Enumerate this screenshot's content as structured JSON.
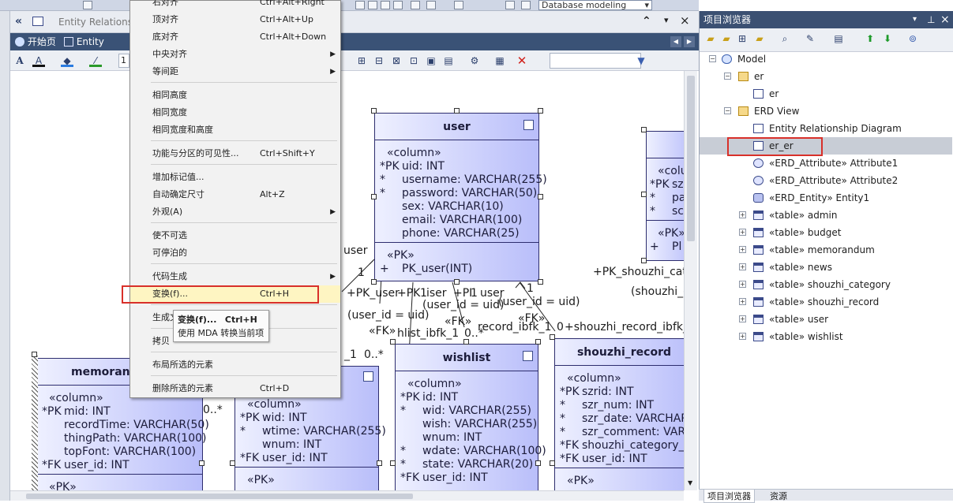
{
  "toolbar": {
    "diagram_type_combo": "Database modeling",
    "combo_arrow": "▾"
  },
  "doc_header": {
    "title": "Entity Relationship",
    "collapse": "«",
    "up": "⌃",
    "close": "×",
    "dropdown": "▾"
  },
  "tabs": {
    "start": "开始页",
    "diagram": "Entity Relatic",
    "prev": "◀",
    "next": "▶"
  },
  "format_toolbar": {
    "font_a": "A",
    "zoom_value": "1"
  },
  "context_menu": {
    "items": [
      {
        "label": "右对齐",
        "shortcut": "Ctrl+Alt+Right"
      },
      {
        "label": "顶对齐",
        "shortcut": "Ctrl+Alt+Up"
      },
      {
        "label": "底对齐",
        "shortcut": "Ctrl+Alt+Down"
      },
      {
        "label": "中央对齐",
        "shortcut": "",
        "submenu": true
      },
      {
        "label": "等间距",
        "shortcut": "",
        "submenu": true
      },
      {
        "label": "相同高度",
        "shortcut": ""
      },
      {
        "label": "相同宽度",
        "shortcut": ""
      },
      {
        "label": "相同宽度和高度",
        "shortcut": ""
      },
      {
        "label": "功能与分区的可见性...",
        "shortcut": "Ctrl+Shift+Y"
      },
      {
        "label": "增加标记值...",
        "shortcut": ""
      },
      {
        "label": "自动确定尺寸",
        "shortcut": "Alt+Z"
      },
      {
        "label": "外观(A)",
        "shortcut": "",
        "submenu": true
      },
      {
        "label": "使不可选",
        "shortcut": ""
      },
      {
        "label": "可停泊的",
        "shortcut": ""
      },
      {
        "label": "代码生成",
        "shortcut": "",
        "submenu": true
      },
      {
        "label": "变换(f)...",
        "shortcut": "Ctrl+H"
      },
      {
        "label": "生成文",
        "shortcut": ""
      },
      {
        "label": "拷贝",
        "shortcut": ""
      },
      {
        "label": "布局所选的元素",
        "shortcut": ""
      },
      {
        "label": "删除所选的元素",
        "shortcut": "Ctrl+D"
      }
    ],
    "submenu_arrow": "▶"
  },
  "tooltip": {
    "title": "变换(f)...",
    "shortcut": "Ctrl+H",
    "desc": "使用 MDA 转换当前项"
  },
  "entities": {
    "user": {
      "name": "user",
      "column_stereo": "«column»",
      "columns": [
        {
          "prefix": "*PK",
          "text": "uid: INT"
        },
        {
          "prefix": "*",
          "text": "username: VARCHAR(255)"
        },
        {
          "prefix": "*",
          "text": "password: VARCHAR(50)"
        },
        {
          "prefix": "",
          "text": "sex: VARCHAR(10)"
        },
        {
          "prefix": "",
          "text": "email: VARCHAR(100)"
        },
        {
          "prefix": "",
          "text": "phone: VARCHAR(25)"
        }
      ],
      "pk_stereo": "«PK»",
      "pk_ops": [
        {
          "prefix": "+",
          "text": "PK_user(INT)"
        }
      ]
    },
    "right_partial": {
      "column_stereo": "«colu",
      "columns": [
        {
          "prefix": "*PK",
          "text": "sz"
        },
        {
          "prefix": "*",
          "text": "pa"
        },
        {
          "prefix": "*",
          "text": "sc"
        }
      ],
      "pk_stereo": "«PK»",
      "pk_ops": [
        {
          "prefix": "+",
          "text": "Pl"
        }
      ]
    },
    "memorandum": {
      "name": "memorand",
      "column_stereo": "«column»",
      "columns": [
        {
          "prefix": "*PK",
          "text": "mid: INT"
        },
        {
          "prefix": "",
          "text": "recordTime: VARCHAR(50)"
        },
        {
          "prefix": "",
          "text": "thingPath: VARCHAR(100)"
        },
        {
          "prefix": "",
          "text": "topFont: VARCHAR(100)"
        },
        {
          "prefix": "*FK",
          "text": "user_id: INT"
        }
      ],
      "pk_stereo": "«PK»"
    },
    "middle": {
      "column_stereo": "«column»",
      "columns": [
        {
          "prefix": "*PK",
          "text": "wid: INT"
        },
        {
          "prefix": "*",
          "text": "wtime: VARCHAR(255)"
        },
        {
          "prefix": "",
          "text": "wnum: INT"
        },
        {
          "prefix": "*FK",
          "text": "user_id: INT"
        }
      ],
      "pk_stereo": "«PK»"
    },
    "wishlist": {
      "name": "wishlist",
      "column_stereo": "«column»",
      "columns": [
        {
          "prefix": "*PK",
          "text": "id: INT"
        },
        {
          "prefix": "*",
          "text": "wid: VARCHAR(255)"
        },
        {
          "prefix": "",
          "text": "wish: VARCHAR(255)"
        },
        {
          "prefix": "",
          "text": "wnum: INT"
        },
        {
          "prefix": "*",
          "text": "wdate: VARCHAR(100)"
        },
        {
          "prefix": "*",
          "text": "state: VARCHAR(20)"
        },
        {
          "prefix": "*FK",
          "text": "user_id: INT"
        }
      ]
    },
    "shouzhi_record": {
      "name": "shouzhi_record",
      "column_stereo": "«column»",
      "columns": [
        {
          "prefix": "*PK",
          "text": "szrid: INT"
        },
        {
          "prefix": "*",
          "text": "szr_num: INT"
        },
        {
          "prefix": "*",
          "text": "szr_date: VARCHAR"
        },
        {
          "prefix": "*",
          "text": "szr_comment: VARC"
        },
        {
          "prefix": "*FK",
          "text": "shouzhi_category_id"
        },
        {
          "prefix": "*FK",
          "text": "user_id: INT"
        }
      ],
      "pk_stereo": "«PK»"
    }
  },
  "connector_labels": {
    "l1": "user",
    "l2": "1",
    "l3": "+PK_user",
    "l4": "+PK",
    "l5": "1",
    "l6": "iser",
    "l7": "+PI",
    "l8": "1",
    "l9": "user",
    "l10": "(user_id = uid)",
    "l11": "1",
    "l12": "(user_id = uid)",
    "l13": "(user_id = uid)",
    "l14": "«FK»",
    "l15": "«FK»",
    "l16": "«FK»",
    "l17": "hlist_ibfk_1",
    "l18": "0..*",
    "l19": "record_ibfk_1",
    "l20": "0",
    "l21": "+shouzhi_record_ibfk_2",
    "l22": "+PK_shouzhi_cate",
    "l23": "(shouzhi_c",
    "l24": "_1",
    "l25": "0..*",
    "l26": "0..*"
  },
  "project_browser": {
    "title": "项目浏览器",
    "pin": "⊥",
    "close": "×",
    "dropdown": "▾",
    "items": [
      {
        "label": "Model",
        "level": 0,
        "exp": "−",
        "icon": "model-icon"
      },
      {
        "label": "er",
        "level": 1,
        "exp": "−",
        "icon": "package-icon"
      },
      {
        "label": "er",
        "level": 2,
        "exp": "",
        "icon": "diagram-icon"
      },
      {
        "label": "ERD View",
        "level": 1,
        "exp": "−",
        "icon": "package-icon"
      },
      {
        "label": "Entity Relationship Diagram",
        "level": 2,
        "exp": "",
        "icon": "diagram-icon"
      },
      {
        "label": "er_er",
        "level": 2,
        "exp": "",
        "icon": "diagram-icon",
        "selected": true
      },
      {
        "label": "«ERD_Attribute» Attribute1",
        "level": 2,
        "exp": "",
        "icon": "ellipse-icon"
      },
      {
        "label": "«ERD_Attribute» Attribute2",
        "level": 2,
        "exp": "",
        "icon": "ellipse-icon"
      },
      {
        "label": "«ERD_Entity» Entity1",
        "level": 2,
        "exp": "",
        "icon": "entity-icon"
      },
      {
        "label": "«table» admin",
        "level": 2,
        "exp": "+",
        "icon": "table-icon"
      },
      {
        "label": "«table» budget",
        "level": 2,
        "exp": "+",
        "icon": "table-icon"
      },
      {
        "label": "«table» memorandum",
        "level": 2,
        "exp": "+",
        "icon": "table-icon"
      },
      {
        "label": "«table» news",
        "level": 2,
        "exp": "+",
        "icon": "table-icon"
      },
      {
        "label": "«table» shouzhi_category",
        "level": 2,
        "exp": "+",
        "icon": "table-icon"
      },
      {
        "label": "«table» shouzhi_record",
        "level": 2,
        "exp": "+",
        "icon": "table-icon"
      },
      {
        "label": "«table» user",
        "level": 2,
        "exp": "+",
        "icon": "table-icon"
      },
      {
        "label": "«table» wishlist",
        "level": 2,
        "exp": "+",
        "icon": "table-icon"
      }
    ],
    "bottom_tabs": {
      "browser": "项目浏览器",
      "resources": "资源"
    }
  }
}
